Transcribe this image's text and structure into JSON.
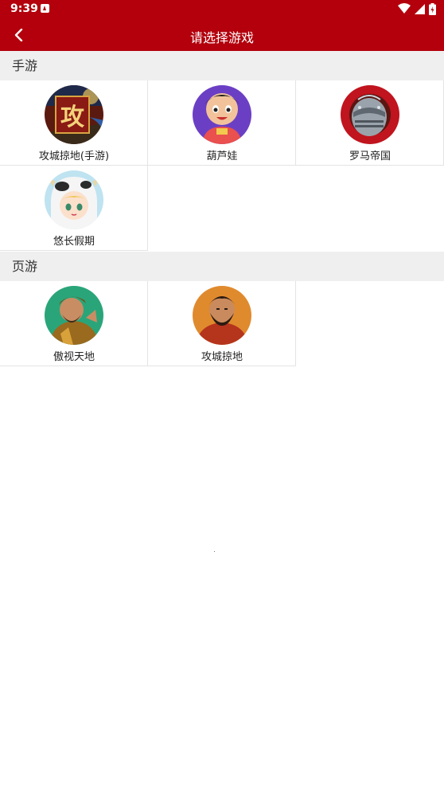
{
  "status": {
    "time": "9:39",
    "notification_icon": "notification-app-icon",
    "wifi_icon": "wifi-icon",
    "signal_icon": "signal-icon",
    "battery_icon": "battery-icon"
  },
  "appbar": {
    "title": "请选择游戏",
    "back_icon": "chevron-left-icon",
    "accent": "#b3000c"
  },
  "sections": [
    {
      "title": "手游",
      "games": [
        {
          "name": "攻城掠地(手游)",
          "icon": "siege-game-icon"
        },
        {
          "name": "葫芦娃",
          "icon": "calabash-brother-icon"
        },
        {
          "name": "罗马帝国",
          "icon": "roman-helmet-icon"
        },
        {
          "name": "悠长假期",
          "icon": "cow-hood-girl-icon"
        }
      ]
    },
    {
      "title": "页游",
      "games": [
        {
          "name": "傲视天地",
          "icon": "general-warrior-icon"
        },
        {
          "name": "攻城掠地",
          "icon": "bearded-general-icon"
        }
      ]
    }
  ]
}
